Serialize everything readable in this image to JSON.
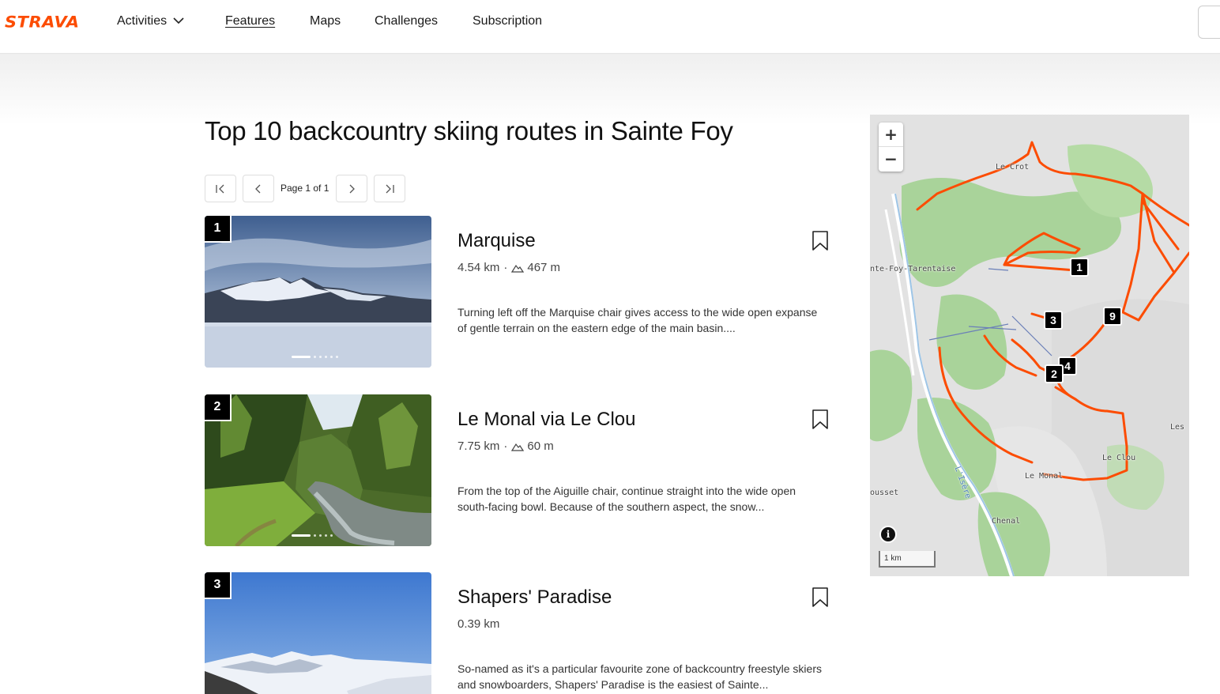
{
  "header": {
    "logo": "STRAVA",
    "nav": [
      {
        "label": "Activities"
      },
      {
        "label": "Features"
      },
      {
        "label": "Maps"
      },
      {
        "label": "Challenges"
      },
      {
        "label": "Subscription"
      }
    ]
  },
  "page": {
    "title": "Top 10 backcountry skiing routes in Sainte Foy"
  },
  "pagination": {
    "label": "Page 1 of 1"
  },
  "routes": [
    {
      "rank": "1",
      "name": "Marquise",
      "distance": "4.54 km",
      "elevation": "467 m",
      "description": "Turning left off the Marquise chair gives access to the wide open expanse of gentle terrain on the eastern edge of the main basin...."
    },
    {
      "rank": "2",
      "name": "Le Monal via Le Clou",
      "distance": "7.75 km",
      "elevation": "60 m",
      "description": "From the top of the Aiguille chair, continue straight into the wide open south-facing bowl. Because of the southern aspect, the snow..."
    },
    {
      "rank": "3",
      "name": "Shapers' Paradise",
      "distance": "0.39 km",
      "elevation": "",
      "description": "So-named as it's a particular favourite zone of backcountry freestyle skiers and snowboarders, Shapers' Paradise is the easiest of Sainte..."
    }
  ],
  "map": {
    "zoom_in": "+",
    "zoom_out": "−",
    "info": "i",
    "scale": "1 km",
    "labels": [
      "Le Crot",
      "nte-Foy-Tarentaise",
      "Les",
      "Le Clou",
      "Le Monal",
      "ousset",
      "L'Isère",
      "Chenal"
    ],
    "markers": [
      "1",
      "3",
      "9",
      "4",
      "2"
    ],
    "route_color": "#fc4c02"
  }
}
